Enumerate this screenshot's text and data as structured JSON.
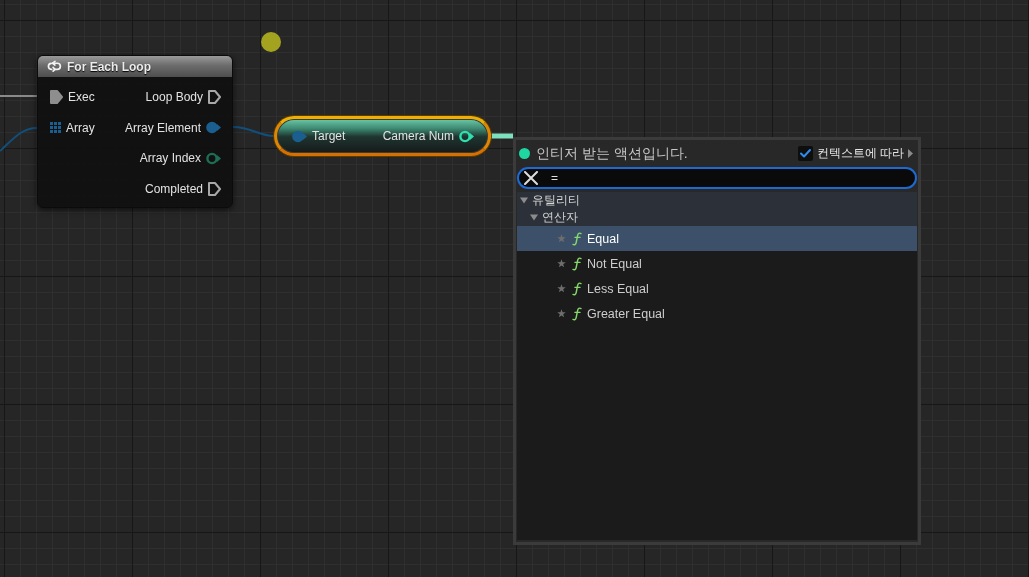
{
  "for_each_loop": {
    "title": "For Each Loop",
    "inputs": [
      {
        "label": "Exec",
        "kind": "exec",
        "connected": true,
        "color": "#8e8e8e"
      },
      {
        "label": "Array",
        "kind": "array",
        "connected": true,
        "color": "#1a5f8f"
      }
    ],
    "outputs": [
      {
        "label": "Loop Body",
        "kind": "exec",
        "connected": false,
        "color": "#a8a8a8"
      },
      {
        "label": "Array Element",
        "kind": "data",
        "connected": true,
        "color": "#1a5f8f"
      },
      {
        "label": "Array Index",
        "kind": "data",
        "connected": false,
        "color": "#1d6e55"
      },
      {
        "label": "Completed",
        "kind": "exec",
        "connected": false,
        "color": "#a8a8a8"
      }
    ]
  },
  "camera_node": {
    "selected": true,
    "inputs": [
      {
        "label": "Target",
        "kind": "data",
        "connected": true,
        "color": "#1a5f8f"
      }
    ],
    "outputs": [
      {
        "label": "Camera Num",
        "kind": "data",
        "connected": false,
        "color": "#2ee0b0"
      }
    ]
  },
  "action_menu": {
    "title": "인티저 받는 액션입니다.",
    "context_sensitive": {
      "label": "컨텍스트에 따라",
      "checked": true
    },
    "search": {
      "value": "="
    },
    "tree": [
      {
        "label": "유틸리티",
        "expanded": true,
        "children": [
          {
            "label": "연산자",
            "expanded": true,
            "children": [
              {
                "label": "Equal",
                "selected": true
              },
              {
                "label": "Not Equal",
                "selected": false
              },
              {
                "label": "Less Equal",
                "selected": false
              },
              {
                "label": "Greater Equal",
                "selected": false
              }
            ]
          }
        ]
      }
    ]
  }
}
